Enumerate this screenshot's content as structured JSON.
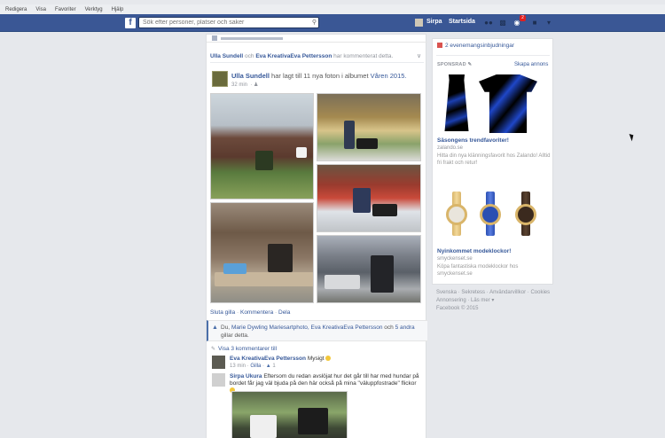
{
  "browser_menu": [
    "Redigera",
    "Visa",
    "Favoriter",
    "Verktyg",
    "Hjälp"
  ],
  "topbar": {
    "logo": "f",
    "search_placeholder": "Sök efter personer, platser och saker",
    "user_name": "Sirpa",
    "home_label": "Startsida",
    "notification_count": "2"
  },
  "story": {
    "header_actor1": "Ulla Sundell",
    "header_mid": "och",
    "header_actor2": "Eva KreativaEva Pettersson",
    "header_tail": "har kommenterat detta.",
    "author": "Ulla Sundell",
    "action_text": "har lagt till 11 nya foton i albumet",
    "album": "Våren 2015.",
    "time": "32 min",
    "actions": [
      "Sluta gilla",
      "Kommentera",
      "Dela"
    ],
    "likes_prefix": "Du,",
    "likes_people": "Marie Dywling Mariesartphoto, Eva KreativaEva Pettersson",
    "likes_and": "och",
    "likes_others": "5 andra",
    "likes_suffix": "gillar detta.",
    "view_comments": "Visa 3 kommentarer till",
    "comments": [
      {
        "author": "Eva KreativaEva Pettersson",
        "text": "Mysigt",
        "time": "13 min",
        "like_label": "Gilla",
        "like_count": "1"
      },
      {
        "author": "Sirpa Ukura",
        "text": "Eftersom du redan avslöjat hur det går till har med hundar på bordet får jag väl bjuda på den här också på mina \"väluppfostrade\" flickor"
      }
    ]
  },
  "sidebar": {
    "events": "2 evenemangsinbjudningar",
    "sponsored": "SPONSRAD",
    "create_ad": "Skapa annons",
    "ad1": {
      "title": "Säsongens trendfavoriter!",
      "domain": "zalando.se",
      "desc": "Hitta din nya klänningsfavorit hos Zalando! Alltid fri frakt och retur!"
    },
    "ad2": {
      "title": "Nyinkommet modeklockor!",
      "domain": "smyckenset.se",
      "desc": "Köpa fantastiska modeklockor hos smyckenset.se"
    },
    "footer": {
      "links": [
        "Svenska",
        "Sekretess",
        "Användarvillkor",
        "Cookies",
        "Annonsering",
        "Läs mer"
      ],
      "copyright": "Facebook © 2015"
    }
  }
}
